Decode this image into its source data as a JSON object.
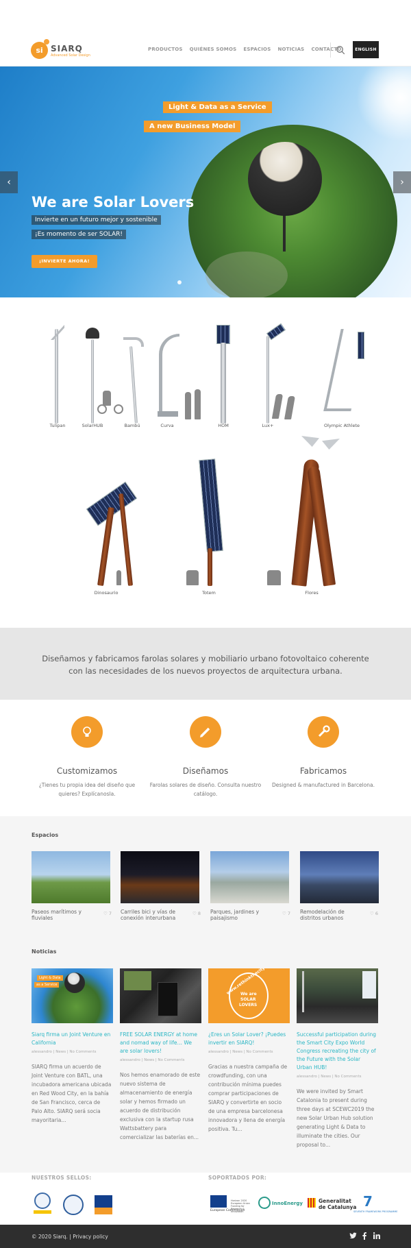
{
  "header": {
    "brand": "SIARQ",
    "tagline": "Advanced Solar Design",
    "nav": [
      "PRODUCTOS",
      "QUIÉNES SOMOS",
      "ESPACIOS",
      "NOTICIAS",
      "CONTACTO"
    ],
    "lang_button": "ENGLISH"
  },
  "hero": {
    "tag1": "Light & Data as a Service",
    "tag2": "A new Business Model",
    "title": "We are Solar Lovers",
    "sub1": "Invierte en un futuro mejor y sostenible",
    "sub2": "¡Es momento de ser SOLAR!",
    "cta": "¡INVIERTE AHORA!"
  },
  "products": {
    "row1": [
      "Tulipan",
      "SolarHUB",
      "Bambú",
      "Curva",
      "HOM",
      "Lux+",
      "Olympic Athlete"
    ],
    "row2": [
      "Dinosaurio",
      "Totem",
      "Flores"
    ]
  },
  "mission": {
    "line1": "Diseñamos y fabricamos farolas solares y mobiliario urbano fotovoltaico coherente",
    "line2": "con las necesidades de los nuevos proyectos de arquitectura urbana."
  },
  "services": [
    {
      "title": "Customizamos",
      "desc1": "¿Tienes tu propia idea del diseño que",
      "desc2": "quieres? Explícanosla."
    },
    {
      "title": "Diseñamos",
      "desc1": "Farolas solares de diseño. Consulta nuestro",
      "desc2": "catálogo."
    },
    {
      "title": "Fabricamos",
      "desc1": "Designed & manufactured in Barcelona.",
      "desc2": ""
    }
  ],
  "espacios": {
    "title": "Espacios",
    "items": [
      {
        "title": "Paseos marítimos y fluviales",
        "count": "7"
      },
      {
        "title": "Carriles bici y vías de conexión interurbana",
        "count": "8"
      },
      {
        "title": "Parques, jardines y paisajismo",
        "count": "7"
      },
      {
        "title": "Remodelación de distritos urbanos",
        "count": "6"
      }
    ]
  },
  "noticias": {
    "title": "Noticias",
    "img1_lines": [
      "Light & Data",
      "as a Service"
    ],
    "img3_lines": [
      "www.rethinkthecity.com",
      "We are",
      "SOLAR",
      "LOVERS"
    ],
    "items": [
      {
        "title": "Siarq firma un Joint Venture en California",
        "meta": "alessandro | News | No Comments",
        "excerpt": "SIARQ firma un acuerdo de Joint Venture con BATL, una incubadora americana ubicada en Red Wood City, en la bahía de San Francisco, cerca de Palo Alto. SIARQ será socia mayoritaria..."
      },
      {
        "title": "FREE SOLAR ENERGY at home and nomad way of life… We are solar lovers!",
        "meta": "alessandro | News | No Comments",
        "excerpt": "Nos hemos enamorado de este nuevo sistema de almacenamiento de energía solar y hemos firmado un acuerdo de distribución exclusiva con la startup rusa Wattsbattery para comercializar las baterías en..."
      },
      {
        "title": "¿Eres un Solar Lover? ¡Puedes invertir en SIARQ!",
        "meta": "alessandro | News | No Comments",
        "excerpt": "Gracias a nuestra campaña de crowdfunding, con una contribución mínima puedes comprar participaciones de SIARQ y convertirte en socio de una empresa barcelonesa innovadora y llena de energía positiva. Tu..."
      },
      {
        "title": "Successful participation during the Smart City Expo World Congress recreating the city of the Future with the Solar Urban HUB!",
        "meta": "alessandro | News | No Comments",
        "excerpt": "We were invited by Smart Catalonia to present during three days at SCEWC2019 the new Solar Urban Hub solution generating Light & Data to illuminate the cities. Our proposal to..."
      }
    ]
  },
  "seals": {
    "label_left": "NUESTROS SELLOS:",
    "label_right": "SOPORTADOS POR:",
    "sponsor_eu": "European Commission",
    "sponsor_eu_desc": "Horizon 2020 European Union Funding for Research & Innovation",
    "sponsor_inno": "InnoEnergy",
    "sponsor_gencat_1": "Generalitat",
    "sponsor_gencat_2": "de Catalunya",
    "sponsor_fp7": "SEVENTH FRAMEWORK PROGRAMME"
  },
  "footer": {
    "copyright": "© 2020 Siarq.",
    "privacy": "Privacy policy",
    "social": [
      "twitter-icon",
      "facebook-icon",
      "linkedin-icon"
    ]
  },
  "colors": {
    "accent": "#f39c2b",
    "link": "#2ab6c4",
    "footer": "#2e2e2e"
  }
}
